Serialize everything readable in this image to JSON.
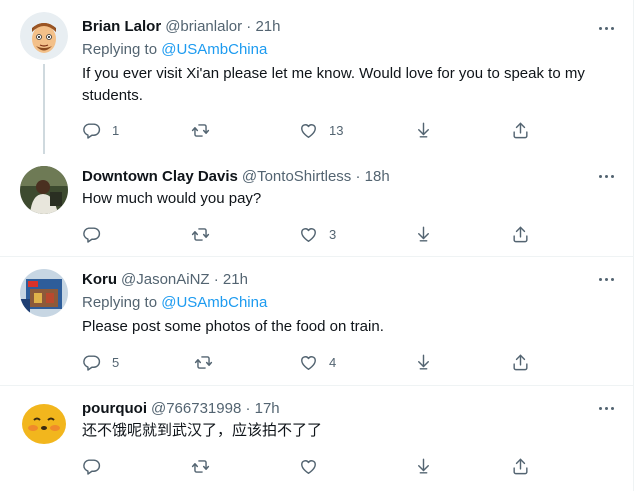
{
  "colors": {
    "accent": "#1d9bf0",
    "text": "#0f1419",
    "muted": "#536471",
    "divider": "#eff3f4"
  },
  "tweets": [
    {
      "name": "Brian Lalor",
      "meta": "@brianlalor · 21h",
      "replying_prefix": "Replying to ",
      "replying_handle": "@USAmbChina",
      "text": "If you ever visit Xi'an please let me know. Would love for you to speak to my students.",
      "reply_count": "1",
      "retweet_count": "",
      "like_count": "13"
    },
    {
      "name": "Downtown Clay Davis",
      "meta": "@TontoShirtless · 18h",
      "text": "How much would you pay?",
      "reply_count": "",
      "retweet_count": "",
      "like_count": "3"
    },
    {
      "name": "Koru",
      "meta": "@JasonAiNZ · 21h",
      "replying_prefix": "Replying to ",
      "replying_handle": "@USAmbChina",
      "text": "Please post some photos of the food on train.",
      "reply_count": "5",
      "retweet_count": "",
      "like_count": "4"
    },
    {
      "name": "pourquoi",
      "meta": "@766731998 · 17h",
      "text": "还不饿呢就到武汉了，应该拍不了了",
      "reply_count": "",
      "retweet_count": "",
      "like_count": ""
    }
  ]
}
